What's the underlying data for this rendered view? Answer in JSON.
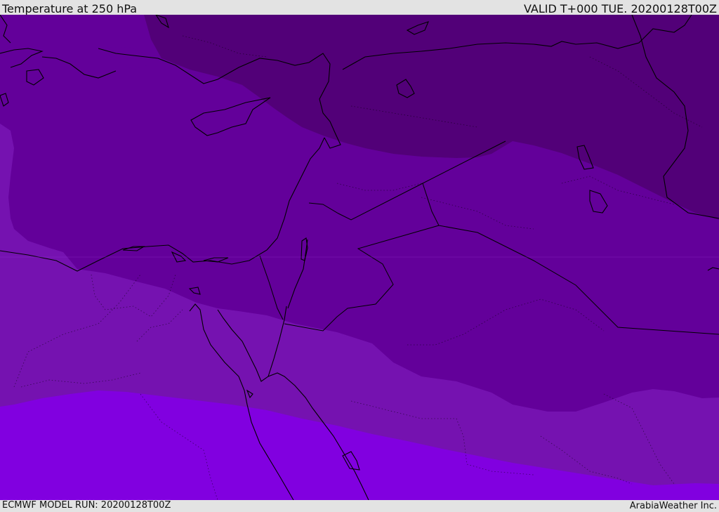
{
  "header": {
    "title": "Temperature at 250 hPa",
    "valid": "VALID T+000 TUE. 20200128T00Z"
  },
  "footer": {
    "model_run": "ECMWF MODEL RUN: 20200128T00Z",
    "credit": "ArabiaWeather Inc."
  },
  "colors": {
    "band_coldest": "#520078",
    "band_cold": "#63009a",
    "band_mild": "#7512b0",
    "band_warm": "#8100e0",
    "coastline": "#000000",
    "borders": "#000000",
    "header_bg": "#e3e3e3"
  }
}
